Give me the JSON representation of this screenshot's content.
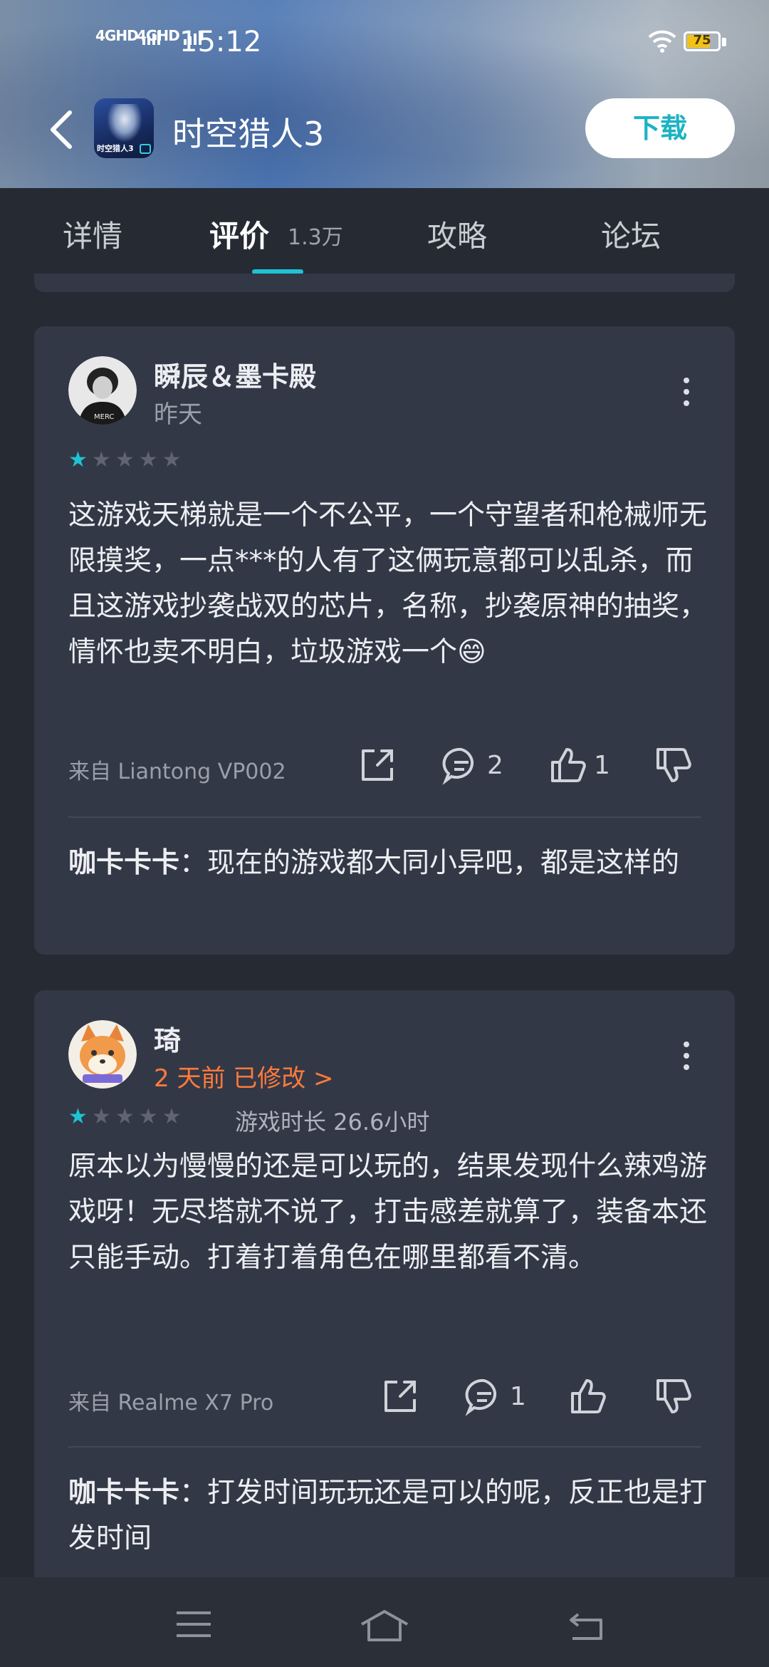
{
  "status": {
    "signal1": "4GHD",
    "signal2": "4GHD",
    "time": "15:12",
    "battery": "75",
    "battery_level": 0.75
  },
  "header": {
    "app_icon_text": "时空猎人3",
    "title": "时空猎人3",
    "download_label": "下载"
  },
  "tabs": [
    {
      "label": "详情"
    },
    {
      "label": "评价",
      "count": "1.3万"
    },
    {
      "label": "攻略"
    },
    {
      "label": "论坛"
    }
  ],
  "reviews": [
    {
      "user": "瞬辰＆墨卡殿",
      "date": "昨天",
      "rating": 1,
      "content": "这游戏天梯就是一个不公平，一个守望者和枪械师无限摸奖，一点***的人有了这俩玩意都可以乱杀，而且这游戏抄袭战双的芯片，名称，抄袭原神的抽奖，情怀也卖不明白，垃圾游戏一个😄",
      "device": "来自 Liantong VP002",
      "comment_count": "2",
      "like_count": "1",
      "reply_user": "咖卡卡卡",
      "reply_text": "：现在的游戏都大同小异吧，都是这样的"
    },
    {
      "user": "琦",
      "date": "2 天前 已修改 >",
      "rating": 1,
      "playtime": "游戏时长 26.6小时",
      "content": "原本以为慢慢的还是可以玩的，结果发现什么辣鸡游戏呀！无尽塔就不说了，打击感差就算了，装备本还只能手动。打着打着角色在哪里都看不清。",
      "device": "来自 Realme  X7 Pro",
      "comment_count": "1",
      "like_count": "",
      "reply_user": "咖卡卡卡",
      "reply_text": "：打发时间玩玩还是可以的呢，反正也是打发时间"
    }
  ],
  "colors": {
    "accent": "#1ec3d4",
    "card_bg": "#333846",
    "page_bg": "#262a33",
    "orange": "#ff7a3c"
  },
  "icons": [
    "back-icon",
    "more-icon",
    "share-icon",
    "comment-icon",
    "like-icon",
    "dislike-icon",
    "menu-icon",
    "home-icon",
    "return-icon"
  ]
}
